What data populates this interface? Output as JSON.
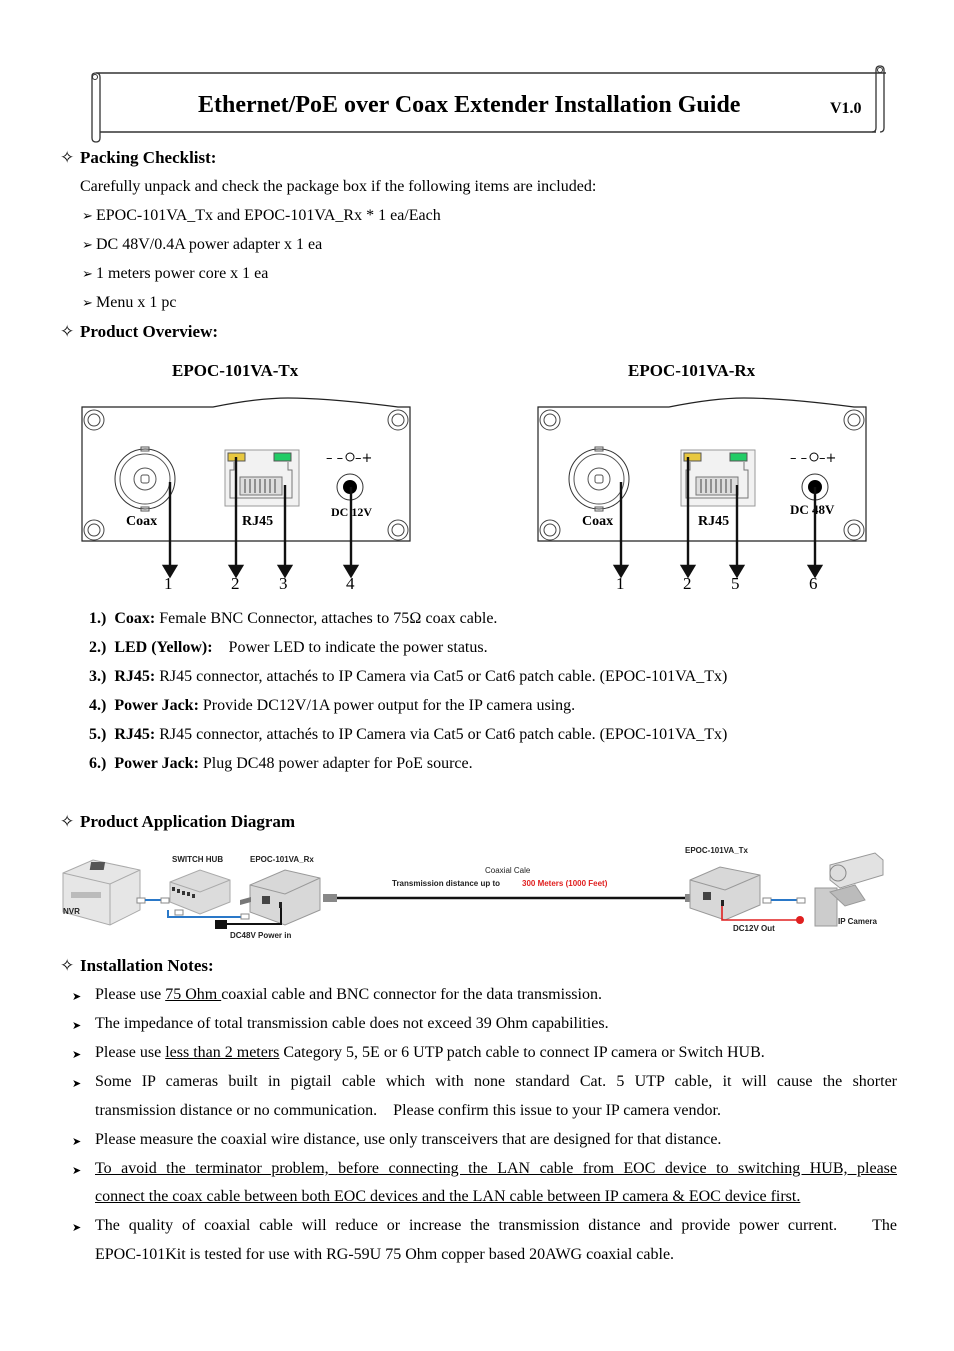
{
  "header": {
    "title": "Ethernet/PoE over Coax Extender Installation Guide",
    "version": "V1.0"
  },
  "packing": {
    "heading": "Packing Checklist:",
    "intro": "Carefully unpack and check the package box if the following items are included:",
    "items": [
      "EPOC-101VA_Tx and EPOC-101VA_Rx * 1 ea/Each",
      "DC 48V/0.4A power adapter x 1 ea",
      "1 meters power core x 1 ea",
      "Menu x 1 pc"
    ]
  },
  "overview": {
    "heading": "Product Overview:",
    "tx": {
      "title": "EPOC-101VA-Tx",
      "coax_label": "Coax",
      "rj45_label": "RJ45",
      "power_label": "DC 12V",
      "polarity": "− −◖− +",
      "callouts": [
        "1",
        "2",
        "3",
        "4"
      ]
    },
    "rx": {
      "title": "EPOC-101VA-Rx",
      "coax_label": "Coax",
      "rj45_label": "RJ45",
      "power_label": "DC 48V",
      "polarity": "− −◖− +",
      "callouts": [
        "1",
        "2",
        "5",
        "6"
      ]
    },
    "led_colors": {
      "power": "#e8c840",
      "link": "#22cc66"
    },
    "features": [
      {
        "num": "1.)",
        "name": "Coax:",
        "desc": "Female BNC Connector, attaches to 75Ω   coax cable."
      },
      {
        "num": "2.)",
        "name": "LED (Yellow):",
        "desc": "   Power LED to indicate the power status."
      },
      {
        "num": "3.)",
        "name": "RJ45:",
        "desc": "RJ45 connector, attachés to IP Camera via Cat5 or Cat6 patch cable. (EPOC-101VA_Tx)"
      },
      {
        "num": "4.)",
        "name": "Power Jack:",
        "desc": "Provide DC12V/1A power output for the IP camera using."
      },
      {
        "num": "5.)",
        "name": "RJ45:",
        "desc": "RJ45 connector, attachés to IP Camera via Cat5 or Cat6 patch cable. (EPOC-101VA_Tx)"
      },
      {
        "num": "6.)",
        "name": "Power Jack:",
        "desc": "Plug DC48 power adapter for PoE source."
      }
    ]
  },
  "application": {
    "heading": "Product Application Diagram",
    "labels": {
      "nvr": "NVR",
      "switch": "SWITCH HUB",
      "rx": "EPOC-101VA_Rx",
      "rx_power": "DC48V Power in",
      "cable_title": "Coaxial Cale",
      "cable_distance_prefix": "Transmission distance up to",
      "cable_distance_value": "300 Meters (1000 Feet)",
      "tx": "EPOC-101VA_Tx",
      "tx_power": "DC12V Out",
      "camera": "IP Camera"
    },
    "colors": {
      "highlight": "#e02020",
      "lan": "#2a78c8"
    }
  },
  "notes": {
    "heading": "Installation Notes:",
    "items": [
      {
        "pre": "Please use ",
        "u": "75 Ohm ",
        "post": "coaxial cable and BNC connector for the data transmission."
      },
      {
        "pre": "The impedance of total transmission cable does not exceed 39 Ohm capabilities.",
        "u": "",
        "post": ""
      },
      {
        "pre": "Please use ",
        "u": "less than 2 meters",
        "post": " Category 5, 5E or 6 UTP patch cable to connect IP camera or Switch HUB."
      },
      {
        "line1": "Some IP cameras built in pigtail cable which with none standard Cat. 5 UTP cable, it will cause the shorter",
        "line2": "transmission distance or no communication.    Please confirm this issue to your IP camera vendor."
      },
      {
        "pre": "Please measure the coaxial wire distance, use only transceivers that are designed for that distance.",
        "u": "",
        "post": ""
      },
      {
        "line1": "To avoid the terminator problem, before connecting the LAN cable from EOC device to switching HUB, please",
        "line2": "connect the coax cable between both EOC devices and the LAN cable between IP camera & EOC device first."
      },
      {
        "line1": "The quality of coaxial cable will reduce or increase the transmission distance and provide power current.    The",
        "line2": "EPOC-101Kit is tested for use with RG-59U 75 Ohm copper based 20AWG coaxial cable."
      }
    ]
  }
}
